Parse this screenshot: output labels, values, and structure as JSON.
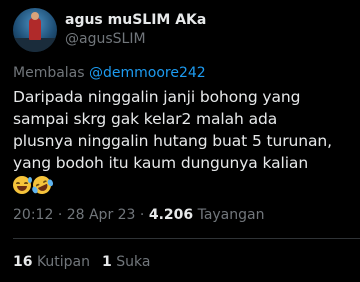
{
  "author": {
    "display_name": "agus muSLIM AKa",
    "handle": "@agusSLIM"
  },
  "reply": {
    "prefix": "Membalas",
    "mention": "@demmoore242"
  },
  "tweet": {
    "text": "Daripada ninggalin janji bohong yang\nsampai skrg gak kelar2 malah ada\nplusnya ninggalin hutang buat 5 turunan,\nyang bodoh itu kaum dungunya kalian",
    "emojis": [
      "grinning-sweat-icon",
      "rofl-icon"
    ]
  },
  "meta": {
    "time": "20:12",
    "sep1": "·",
    "date": "28 Apr 23",
    "sep2": "·",
    "views": "4.206",
    "views_label": "Tayangan"
  },
  "stats": {
    "quotes_count": "16",
    "quotes_label": "Kutipan",
    "likes_count": "1",
    "likes_label": "Suka"
  },
  "colors": {
    "background": "#000000",
    "text_primary": "#e7e9ea",
    "text_secondary": "#71767b",
    "link": "#1d9bf0",
    "divider": "#2f3336"
  }
}
